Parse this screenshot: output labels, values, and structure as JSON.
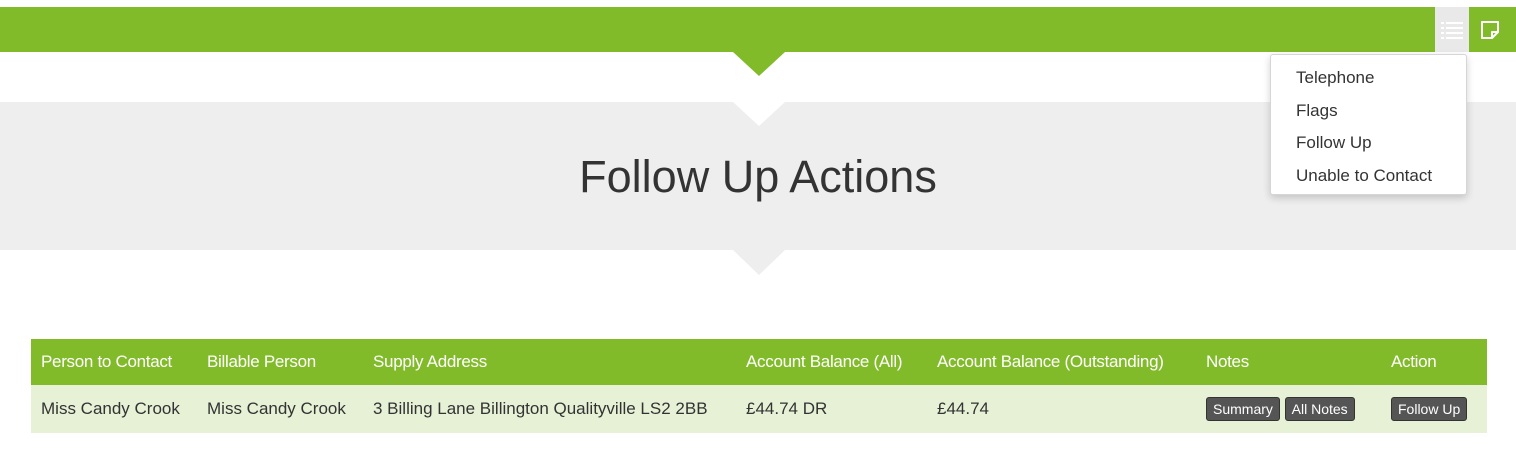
{
  "header": {
    "list_icon": "list-icon",
    "note_icon": "sticky-note-icon",
    "brand_color": "#82bb2a"
  },
  "menu": {
    "items": [
      {
        "label": "Telephone"
      },
      {
        "label": "Flags"
      },
      {
        "label": "Follow Up"
      },
      {
        "label": "Unable to Contact"
      }
    ]
  },
  "page": {
    "title": "Follow Up Actions"
  },
  "table": {
    "columns": [
      "Person to Contact",
      "Billable Person",
      "Supply Address",
      "Account Balance (All)",
      "Account Balance (Outstanding)",
      "Notes",
      "Action"
    ],
    "rows": [
      {
        "person_to_contact": "Miss Candy Crook",
        "billable_person": "Miss Candy Crook",
        "supply_address": "3 Billing Lane Billington Qualityville LS2 2BB",
        "balance_all": "£44.74 DR",
        "balance_outstanding": "£44.74",
        "notes_summary_label": "Summary",
        "notes_all_label": "All Notes",
        "action_label": "Follow Up"
      }
    ]
  }
}
